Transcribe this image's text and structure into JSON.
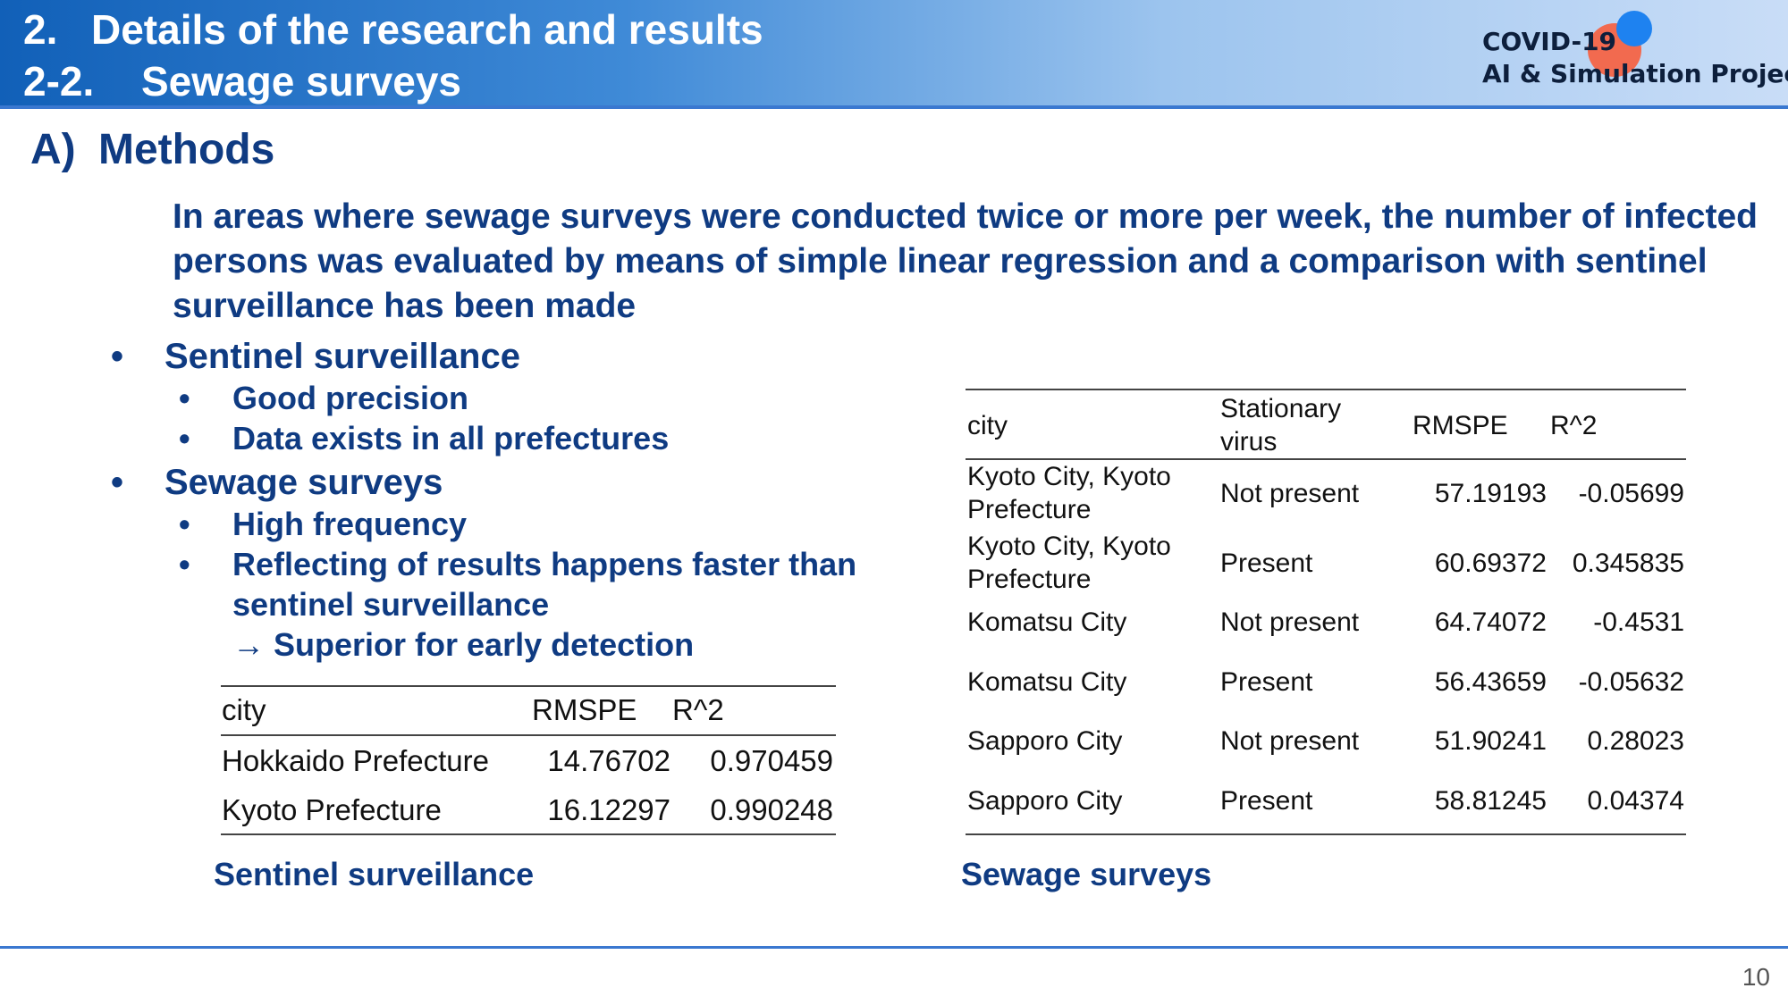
{
  "header": {
    "line1_num": "2.",
    "line1_text": "Details of the research and results",
    "line2_num": "2-2.",
    "line2_text": "Sewage surveys"
  },
  "logo": {
    "line1": "COVID-19",
    "line2": "AI & Simulation Project",
    "colors": {
      "red": "#f26a4f",
      "blue": "#1e82f0"
    }
  },
  "section": {
    "letter": "A)",
    "title": "Methods"
  },
  "intro": "In areas where sewage surveys were conducted twice or more per week, the number of infected persons was evaluated by means of simple linear regression and a comparison with sentinel surveillance has been made",
  "bullets": {
    "sentinel": {
      "title": "Sentinel surveillance",
      "items": [
        "Good precision",
        "Data exists in all prefectures"
      ]
    },
    "sewage": {
      "title": "Sewage surveys",
      "items": [
        "High frequency",
        "Reflecting of results happens faster than",
        "sentinel surveillance",
        "→ Superior for early detection"
      ]
    },
    "bullet_char": "•"
  },
  "table_sentinel": {
    "headers": [
      "city",
      "RMSPE",
      "R^2"
    ],
    "rows": [
      [
        "Hokkaido Prefecture",
        "14.76702",
        "0.970459"
      ],
      [
        "Kyoto Prefecture",
        "16.12297",
        "0.990248"
      ]
    ],
    "caption": "Sentinel surveillance"
  },
  "table_sewage": {
    "headers": [
      "city",
      "Stationary",
      "virus",
      "RMSPE",
      "R^2"
    ],
    "rows": [
      [
        "Kyoto City, Kyoto",
        "Prefecture",
        "Not present",
        "57.19193",
        "-0.05699"
      ],
      [
        "Kyoto City, Kyoto",
        "Prefecture",
        "Present",
        "60.69372",
        "0.345835"
      ],
      [
        "Komatsu City",
        "",
        "Not present",
        "64.74072",
        "-0.4531"
      ],
      [
        "Komatsu City",
        "",
        "Present",
        "56.43659",
        "-0.05632"
      ],
      [
        "Sapporo City",
        "",
        "Not present",
        "51.90241",
        "0.28023"
      ],
      [
        "Sapporo City",
        "",
        "Present",
        "58.81245",
        "0.04374"
      ]
    ],
    "caption": "Sewage surveys"
  },
  "page_number": "10",
  "theme": {
    "primary": "#0f3b82",
    "accent": "#3a78d0"
  }
}
